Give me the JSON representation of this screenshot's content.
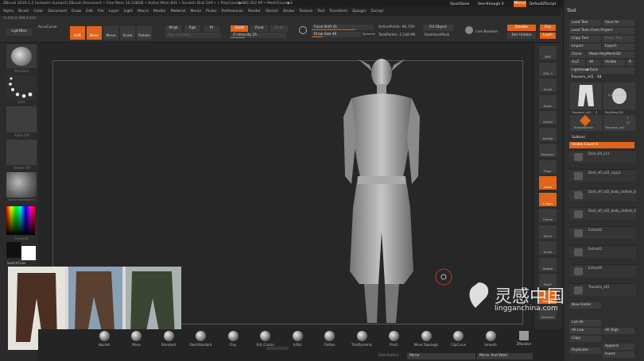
{
  "titlebar": {
    "text": "ZBrush 2019.1.2 [aclealm durnant]   ZBrush Document   • Free Mem 10.338GB • Active Mem 841 • Scratch Disk 549 • • PolyCount▶882.202 KP • MeshCount▶2"
  },
  "topright": {
    "quicksave": "QuickSave",
    "seethrough": "See-through",
    "seethrough_value": "0",
    "menus": "Menus",
    "script": "DefaultZScript"
  },
  "menu": [
    "Alpha",
    "Brush",
    "Color",
    "Document",
    "Draw",
    "Edit",
    "File",
    "Layer",
    "Light",
    "Macro",
    "Marker",
    "Material",
    "Movie",
    "Picker",
    "Preferences",
    "Render",
    "Stencil",
    "Stroke",
    "Texture",
    "Tool",
    "Transform",
    "Zplugin",
    "Zscript"
  ],
  "toolbar": {
    "coords": "0.201,0.394,0.031",
    "lightbox": "LightBox",
    "accucurve": "AccuCurve",
    "edit": "Edit",
    "draw": "Draw",
    "move": "Move",
    "scale": "Scale",
    "rotate": "Rotate",
    "mrgb": "Mrgb",
    "rgb": "Rgb",
    "m": "M",
    "zadd": "Zadd",
    "zsub": "Zsub",
    "zcut": "Zcut",
    "rgb_intensity": "Rgb Intensity",
    "z_intensity": "Z Intensity 25",
    "z_intensity_value": 25,
    "focal_shift": "Focal Shift 41",
    "focal_shift_value": 41,
    "draw_size": "Draw Size 46",
    "draw_size_value": 46,
    "dynamic": "Dynamic",
    "active_points": "ActivePoints: 96,729",
    "total_points": "TotalPoints: 2.148 Mil",
    "fill_object": "Fill Object",
    "backface_mask": "BackfaceMask",
    "live_boolean": "Live Boolean",
    "double": "Double",
    "del_hidden": "Del Hidden",
    "grp": "Grp",
    "lsym": "Lsym"
  },
  "leftpanel": {
    "standard": "Standard",
    "dots": "Dots",
    "alpha_off": "Alpha Off",
    "texture_off": "Texture Off",
    "matcap": "SkinShadeMaterial",
    "gradient": "Gradient",
    "switch_color": "SwitchColor",
    "alternate": "Alternate"
  },
  "rightbar": [
    "BPR",
    "SPix 3",
    "Scroll",
    "Zoom",
    "Actual",
    "AAHalf",
    "Dynamic Persp",
    "Floor",
    "Local",
    "L.Sym",
    "Frame",
    "Move",
    "Scale",
    "Rotate",
    "PolyF",
    "Transp",
    "Dynamic"
  ],
  "toolpanel": {
    "title": "Tool",
    "load_tool": "Load Tool",
    "save_as": "Save As",
    "load_from_project": "Load Tools From Project",
    "copy_tool": "Copy Tool",
    "paste_tool": "Paste Tool",
    "import": "Import",
    "export": "Export",
    "clone": "Clone",
    "make_polymesh": "Make PolyMesh3D",
    "goz": "GoZ",
    "all": "All",
    "visible": "Visible",
    "r": "R",
    "lightbox_tools": "Lightbox▶Tools",
    "current_tool": "Trousers_v01 . 48",
    "thumbs": [
      "Trousers_v01",
      "Cylinder3D",
      "PolyMesh3D",
      "SimpleBrush",
      "Trousers_v01"
    ],
    "thumb_counts": [
      "2",
      "1",
      "27"
    ],
    "subtool_header": "Subtool",
    "visible_count": "Visible Count 8",
    "subtools": [
      "Dark_Elf_v11",
      "Dark_elf_v02_copy1",
      "Dark_elf_v02_body_clothes_blo",
      "Dark_elf_v02_body_clothes_Shi",
      "Extract2",
      "Extract1",
      "Extract0",
      "Trousers_v01"
    ],
    "new_folder": "New Folder",
    "list_all": "List All",
    "all_high": "All High",
    "copy": "Copy",
    "duplicate": "Duplicate",
    "append": "Append",
    "insert": "Insert"
  },
  "bottom": {
    "brushes": [
      "Hpolish",
      "Move",
      "Standard",
      "DamStandard",
      "Clay",
      "Orb_Cracks",
      "Inflat",
      "Flatten",
      "TrimDynamic",
      "Pinch",
      "Move Topologic",
      "ClipCurve",
      "Smooth"
    ],
    "zmodeler": "ZModeler",
    "edit_outline": "Edit Outline",
    "mirror": "Mirror",
    "mirror_and_weld": "Mirror And Weld"
  },
  "colors": {
    "accent": "#e0641a",
    "bg": "#2b2b2b"
  },
  "watermark": {
    "cn": "灵感中国",
    "url": "lingganchina.com"
  }
}
